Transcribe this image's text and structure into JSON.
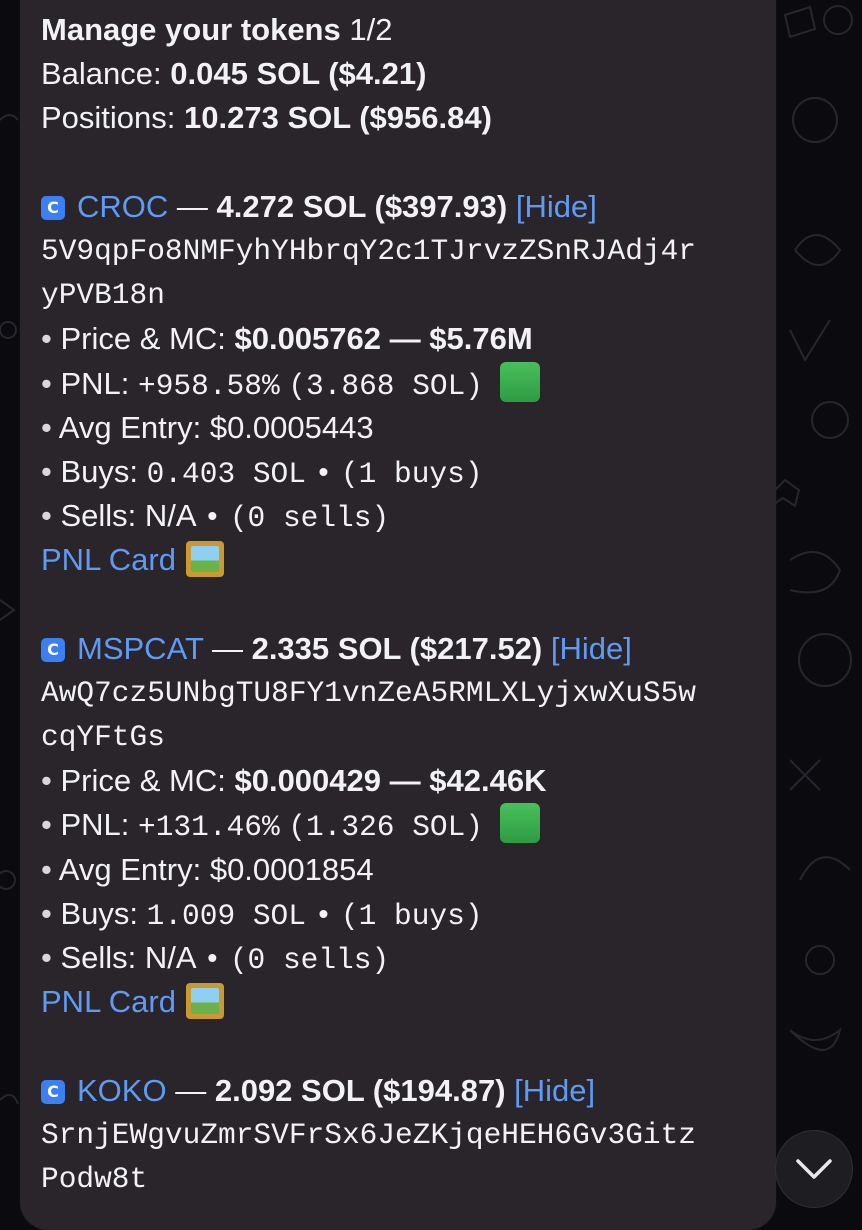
{
  "header": {
    "title": "Manage your tokens",
    "page": "1/2",
    "balance_label": "Balance:",
    "balance_value": "0.045 SOL ($4.21)",
    "positions_label": "Positions:",
    "positions_value": "10.273 SOL ($956.84)"
  },
  "labels": {
    "dash": "—",
    "hide": "[Hide]",
    "price_mc": "Price & MC:",
    "pnl": "PNL:",
    "avg_entry": "Avg Entry:",
    "buys": "Buys:",
    "sells": "Sells:",
    "pnl_card": "PNL Card",
    "bullet": "•",
    "ticker_icon": "C"
  },
  "tokens": [
    {
      "symbol": "CROC",
      "amount": "4.272 SOL ($397.93)",
      "address_line1": "5V9qpFo8NMFyhYHbrqY2c1TJrvzZSnRJAdj4r",
      "address_line2": "yPVB18n",
      "price": "$0.005762",
      "mc": "$5.76M",
      "pnl_pct": "+958.58%",
      "pnl_sol": "(3.868 SOL)",
      "avg_entry": "$0.0005443",
      "buys_amount": "0.403 SOL",
      "buys_count": "(1 buys)",
      "sells_amount": "N/A",
      "sells_count": "(0 sells)"
    },
    {
      "symbol": "MSPCAT",
      "amount": "2.335 SOL ($217.52)",
      "address_line1": "AwQ7cz5UNbgTU8FY1vnZeA5RMLXLyjxwXuS5w",
      "address_line2": "cqYFtGs",
      "price": "$0.000429",
      "mc": "$42.46K",
      "pnl_pct": "+131.46%",
      "pnl_sol": "(1.326 SOL)",
      "avg_entry": "$0.0001854",
      "buys_amount": "1.009 SOL",
      "buys_count": "(1 buys)",
      "sells_amount": "N/A",
      "sells_count": "(0 sells)"
    },
    {
      "symbol": "KOKO",
      "amount": "2.092 SOL ($194.87)",
      "address_line1": "SrnjEWgvuZmrSVFrSx6JeZKjqeHEH6Gv3Gitz",
      "address_line2": "Podw8t"
    }
  ],
  "icons": {
    "ticker": "coin-c-icon",
    "profit": "green-square-icon",
    "pnl_card": "framed-picture-icon",
    "scroll": "chevron-down-icon"
  },
  "colors": {
    "link": "#5f9bf5",
    "bubble": "#2a242b",
    "background": "#0b0b0f",
    "text": "#f2f2f4"
  }
}
